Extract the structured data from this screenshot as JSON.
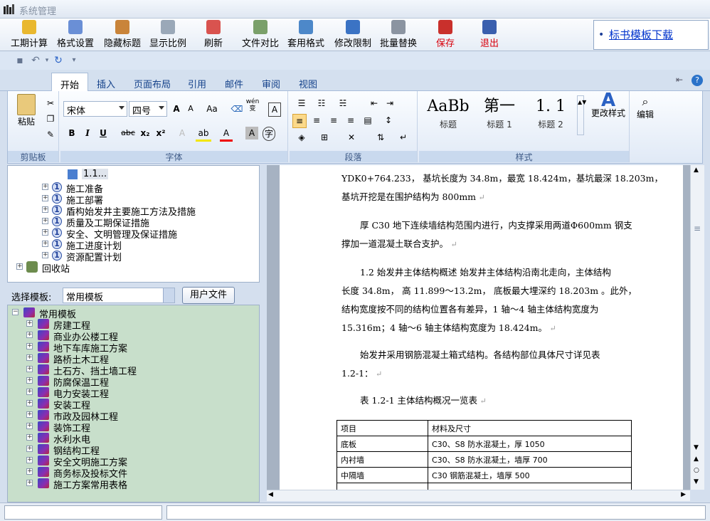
{
  "window": {
    "title": "系统管理"
  },
  "toolbar": {
    "buttons": [
      {
        "label": "工期计算"
      },
      {
        "label": "格式设置"
      },
      {
        "label": "隐藏标题"
      },
      {
        "label": "显示比例"
      },
      {
        "label": "刷新"
      },
      {
        "label": "文件对比"
      },
      {
        "label": "套用格式"
      },
      {
        "label": "修改限制"
      },
      {
        "label": "批量替换"
      },
      {
        "label": "保存"
      },
      {
        "label": "退出"
      }
    ],
    "link": "标书模板下载"
  },
  "ribbon": {
    "tabs": [
      "开始",
      "插入",
      "页面布局",
      "引用",
      "邮件",
      "审阅",
      "视图"
    ],
    "clipboard": {
      "paste": "粘贴",
      "label": "剪贴板"
    },
    "font": {
      "name": "宋体",
      "size": "四号",
      "label": "字体",
      "wen": "wén",
      "wen_char": "变",
      "case": "Aa"
    },
    "paragraph": {
      "label": "段落"
    },
    "styles": {
      "cards": [
        {
          "preview": "AaBb",
          "name": "标题"
        },
        {
          "preview": "第一",
          "name": "标题 1"
        },
        {
          "preview": "1. 1",
          "name": "标题 2"
        }
      ],
      "change": "更改样式",
      "label": "样式"
    },
    "edit": {
      "label": "编辑"
    }
  },
  "tree_top": {
    "first_child": "1.1...",
    "items": [
      "施工准备",
      "施工部署",
      "盾构始发井主要施工方法及措施",
      "质量及工期保证措施",
      "安全、文明管理及保证措施",
      "施工进度计划",
      "资源配置计划"
    ],
    "recycle": "回收站"
  },
  "template_select": {
    "label": "选择模板:",
    "value": "常用模板",
    "user_file": "用户文件"
  },
  "tree_bottom": {
    "root": "常用模板",
    "items": [
      "房建工程",
      "商业办公楼工程",
      "地下车库施工方案",
      "路桥土木工程",
      "土石方、挡土墙工程",
      "防腐保温工程",
      "电力安装工程",
      "安装工程",
      "市政及园林工程",
      "装饰工程",
      "水利水电",
      "钢结构工程",
      "安全文明施工方案",
      "商务标及投标文件",
      "施工方案常用表格"
    ]
  },
  "document": {
    "lines": [
      "YDK0+764.233， 基坑长度为 34.8m，最宽 18.424m，基坑最深 18.203m，",
      "基坑开挖是在围护结构为 800mm",
      "厚 C30 地下连续墙结构范围内进行，内支撑采用两道Φ600mm 钢支",
      "撑加一道混凝土联合支护。",
      "1.2  始发井主体结构概述  始发井主体结构沿南北走向，主体结构",
      "长度 34.8m，  高 11.899～13.2m，  底板最大埋深约 18.203m 。此外，",
      "结构宽度按不同的结构位置各有差异，1 轴～4 轴主体结构宽度为",
      "15.316m；4 轴～6 轴主体结构宽度为 18.424m。",
      "始发井采用钢筋混凝土箱式结构。各结构部位具体尺寸详见表",
      "1.2-1：",
      "表 1.2-1 主体结构概况一览表"
    ],
    "table": {
      "rows": [
        [
          "项目",
          "材料及尺寸"
        ],
        [
          "底板",
          "C30、S8  防水混凝土，厚 1050"
        ],
        [
          "内衬墙",
          "C30、S8  防水混凝土，墙厚 700"
        ],
        [
          "中隔墙",
          "C30  钢筋混凝土，墙厚 500"
        ],
        [
          "",
          ""
        ]
      ]
    }
  }
}
